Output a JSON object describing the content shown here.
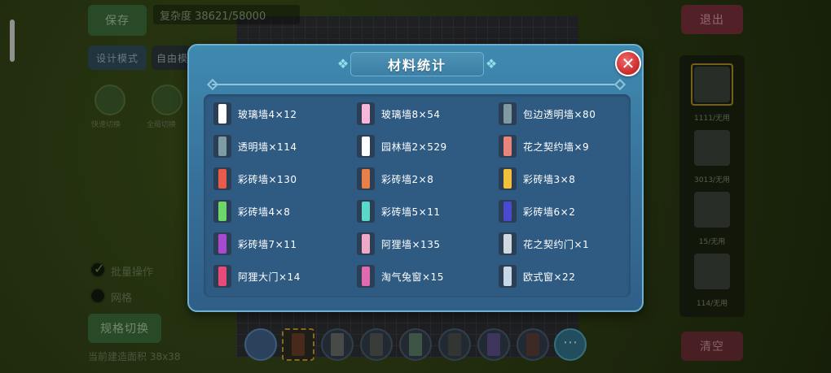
{
  "background": {
    "save_label": "保存",
    "complexity_text": "复杂度 38621/58000",
    "design_mode_label": "设计模式",
    "free_mode_label": "自由模",
    "exit_label": "退出",
    "clear_label": "清空",
    "switch_label": "规格切换",
    "batch_op_label": "批量操作",
    "grid_toggle_label": "网格",
    "area_label": "当前建造面积 38x38",
    "avatar_labels": [
      "快速切换",
      "全局切换"
    ],
    "right_panel_labels": [
      "1111/无用",
      "3013/无用",
      "15/无用",
      "114/无用"
    ]
  },
  "modal": {
    "title": "材料统计",
    "close_icon": "close-icon",
    "items": [
      {
        "label": "玻璃墙4×12",
        "icon": "glass-wall",
        "color": "#ffffff"
      },
      {
        "label": "玻璃墙8×54",
        "icon": "glass-wall-pink",
        "color": "#f5b8d8"
      },
      {
        "label": "包边透明墙×80",
        "icon": "trim-transparent-wall",
        "color": "#7f9aa0"
      },
      {
        "label": "透明墙×114",
        "icon": "transparent-wall",
        "color": "#7f9ca6"
      },
      {
        "label": "园林墙2×529",
        "icon": "garden-wall",
        "color": "#ffffff"
      },
      {
        "label": "花之契约墙×9",
        "icon": "flower-contract-wall",
        "color": "#e8857a"
      },
      {
        "label": "彩砖墙×130",
        "icon": "color-brick-wall-red",
        "color": "#e85a4a"
      },
      {
        "label": "彩砖墙2×8",
        "icon": "color-brick-wall-orange",
        "color": "#e8804a"
      },
      {
        "label": "彩砖墙3×8",
        "icon": "color-brick-wall-yellow",
        "color": "#f2c03a"
      },
      {
        "label": "彩砖墙4×8",
        "icon": "color-brick-wall-green",
        "color": "#6fd66a"
      },
      {
        "label": "彩砖墙5×11",
        "icon": "color-brick-wall-cyan",
        "color": "#5ad8c8"
      },
      {
        "label": "彩砖墙6×2",
        "icon": "color-brick-wall-blue",
        "color": "#4a4ad0"
      },
      {
        "label": "彩砖墙7×11",
        "icon": "color-brick-wall-purple",
        "color": "#a84ad0"
      },
      {
        "label": "阿狸墙×135",
        "icon": "ali-wall",
        "color": "#f0a8c8"
      },
      {
        "label": "花之契约门×1",
        "icon": "flower-contract-door",
        "color": "#d0d8e0"
      },
      {
        "label": "阿狸大门×14",
        "icon": "ali-gate",
        "color": "#e84a7a"
      },
      {
        "label": "淘气兔窗×15",
        "icon": "naughty-rabbit-window",
        "color": "#e06ab0"
      },
      {
        "label": "欧式窗×22",
        "icon": "european-window",
        "color": "#c8d8e8"
      }
    ]
  }
}
